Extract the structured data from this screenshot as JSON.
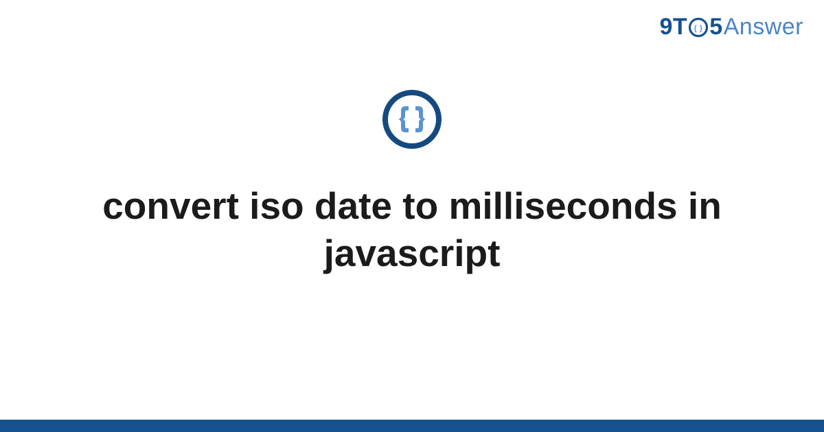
{
  "page": {
    "title": "convert iso date to milliseconds in javascript"
  },
  "logo": {
    "nine": "9",
    "t": "T",
    "five": "5",
    "answer": "Answer"
  },
  "icon": {
    "name": "code-braces-icon",
    "ring_color": "#154a80",
    "brace_color": "#5b93cf"
  },
  "footer": {
    "bar_color": "#16518f"
  }
}
